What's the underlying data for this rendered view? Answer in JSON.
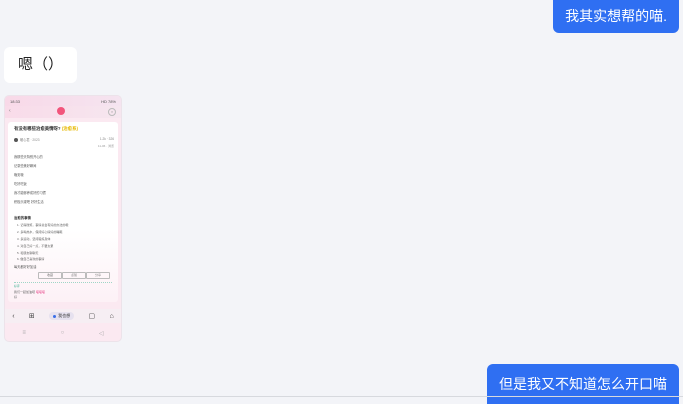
{
  "chat": {
    "message_1": "我其实想帮的喵.",
    "message_2": "嗯（）",
    "message_4": "但是我又不知道怎么开口喵"
  },
  "screenshot": {
    "status_time": "18:33",
    "status_icons": "HD 78%",
    "title": "有没有哪些治愈美情呀?",
    "title_highlight": "(治愈系)",
    "author": "暖心君 · 2023",
    "meta": "1.2k · 326",
    "meta2": "11-06 · 浏览",
    "lines": [
      "我那些天特别开心的",
      "记录些美好瞬间",
      "晚安哦",
      "吃好吃饭",
      "我才能够养成好的习惯",
      "积极乐观吧 好好生活"
    ],
    "section": "治愈的事情",
    "steps": [
      "1. 记得微笑，事情总会有好的办法的哦",
      "2. 多喝热水，保持好心情好的睡眠",
      "3. 多运动，坚持锻炼身体",
      "4. 对自己好一点，不要太累",
      "5. 和朋友聊聊天",
      "6. 做自己喜欢的事情"
    ],
    "tail": "每天都好好加油",
    "buttons": [
      "收藏",
      "点赞",
      "分享"
    ],
    "green_note": "好评",
    "footer": "我们一起加油吧",
    "footer_pink": "喵喵喵",
    "footer_2": "好",
    "toolbar_pill": "我也想",
    "nav": [
      "≡",
      "○",
      "◁"
    ]
  },
  "colors": {
    "accent": "#2f6ff2",
    "background": "#f3f4f8"
  }
}
